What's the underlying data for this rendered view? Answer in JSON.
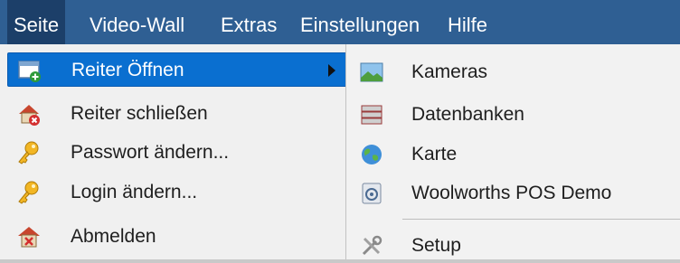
{
  "menubar": {
    "items": [
      {
        "label": "Seite"
      },
      {
        "label": "Video-Wall"
      },
      {
        "label": "Extras"
      },
      {
        "label": "Einstellungen"
      },
      {
        "label": "Hilfe"
      }
    ]
  },
  "main_menu": {
    "items": [
      {
        "label": "Reiter Öffnen",
        "icon": "open-tab-icon"
      },
      {
        "label": "Reiter schließen",
        "icon": "close-tab-icon"
      },
      {
        "label": "Passwort ändern...",
        "icon": "key-icon"
      },
      {
        "label": "Login ändern...",
        "icon": "key-icon"
      },
      {
        "label": "Abmelden",
        "icon": "logout-icon"
      }
    ]
  },
  "submenu": {
    "items": [
      {
        "label": "Kameras",
        "icon": "camera-image-icon"
      },
      {
        "label": "Datenbanken",
        "icon": "database-icon"
      },
      {
        "label": "Karte",
        "icon": "globe-icon"
      },
      {
        "label": "Woolworths POS Demo",
        "icon": "pos-demo-icon"
      },
      {
        "label": "Setup",
        "icon": "tools-icon"
      }
    ]
  },
  "colors": {
    "menubar": "#2f5f93",
    "menubar_active": "#1c3f69",
    "highlight": "#0a6fd0",
    "menu_bg": "#f0f0f0"
  }
}
